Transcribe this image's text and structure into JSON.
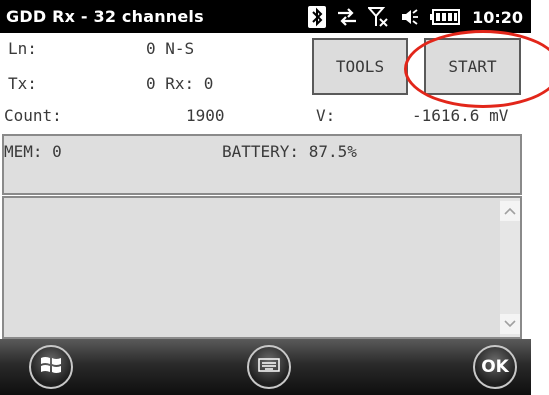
{
  "status_bar": {
    "title": "GDD Rx - 32 channels",
    "time": "10:20",
    "icons": [
      "bluetooth-icon",
      "data-sync-icon",
      "no-signal-icon",
      "volume-icon",
      "battery-icon"
    ]
  },
  "readout": {
    "ln_label": "Ln:",
    "ln_value": "0 N-S",
    "tx_label": "Tx:",
    "tx_value": "0 Rx: 0",
    "count_label": "Count:",
    "count_value": "1900",
    "v_label": "V:",
    "v_value": "-1616.6 mV"
  },
  "buttons": {
    "tools": "TOOLS",
    "start": "START"
  },
  "status_panel": {
    "mem": "MEM: 0",
    "battery": "BATTERY: 87.5%"
  },
  "bottom_bar": {
    "ok": "OK",
    "icons": [
      "windows-start-icon",
      "keyboard-icon"
    ]
  },
  "colors": {
    "annotation": "#e2261a",
    "panel_bg": "#dedede"
  }
}
